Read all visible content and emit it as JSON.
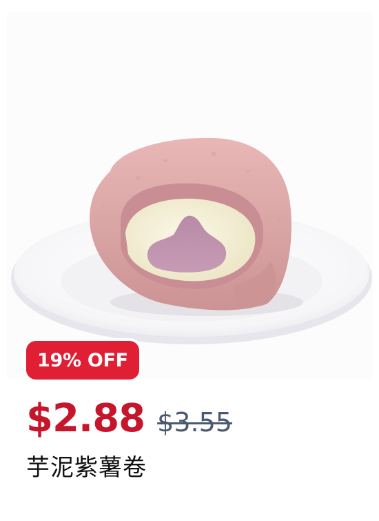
{
  "product": {
    "image_alt": "taro swiss roll",
    "discount_badge": "19% OFF",
    "price_current": "$2.88",
    "price_original": "$3.55",
    "name": "芋泥紫薯卷"
  },
  "colors": {
    "badge_bg": "#e01e34",
    "price_current": "#c6162b",
    "price_original": "#4a5a6e"
  }
}
